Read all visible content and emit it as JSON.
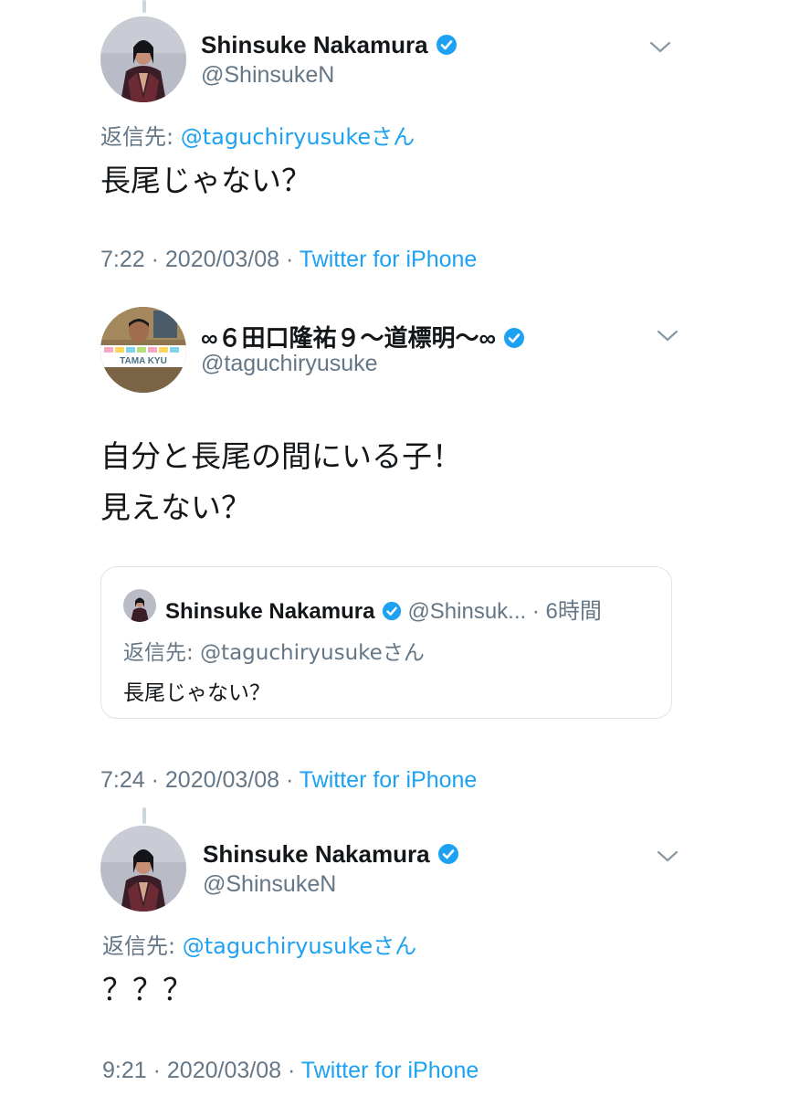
{
  "colors": {
    "link": "#1da1f2",
    "muted": "#657786",
    "text": "#14171a",
    "verified": "#1da1f2"
  },
  "tweets": [
    {
      "name": "Shinsuke Nakamura",
      "handle": "@ShinsukeN",
      "reply_prefix": "返信先: ",
      "reply_mention": "@taguchiryusukeさん",
      "text_lines": [
        "長尾じゃない？"
      ],
      "time": "7:22",
      "date": "2020/03/08",
      "source": "Twitter for iPhone",
      "menu_icon": "chevron-down-icon",
      "verified_icon": "verified-badge-icon"
    },
    {
      "name": "∞６田口隆祐９〜道標明〜∞",
      "handle": "@taguchiryusuke",
      "avatar_banner": "TAMA KYU",
      "text_lines": [
        "自分と長尾の間にいる子！",
        "見えない？"
      ],
      "time": "7:24",
      "date": "2020/03/08",
      "source": "Twitter for iPhone",
      "quote": {
        "name": "Shinsuke Nakamura",
        "handle_time": "@Shinsuk... · 6時間",
        "reply_prefix": "返信先: ",
        "reply_mention": "@taguchiryusukeさん",
        "text": "長尾じゃない？"
      }
    },
    {
      "name": "Shinsuke Nakamura",
      "handle": "@ShinsukeN",
      "reply_prefix": "返信先: ",
      "reply_mention": "@taguchiryusukeさん",
      "text_lines": [
        "？？？"
      ],
      "time": "9:21",
      "date": "2020/03/08",
      "source": "Twitter for iPhone"
    }
  ],
  "separator": " · "
}
